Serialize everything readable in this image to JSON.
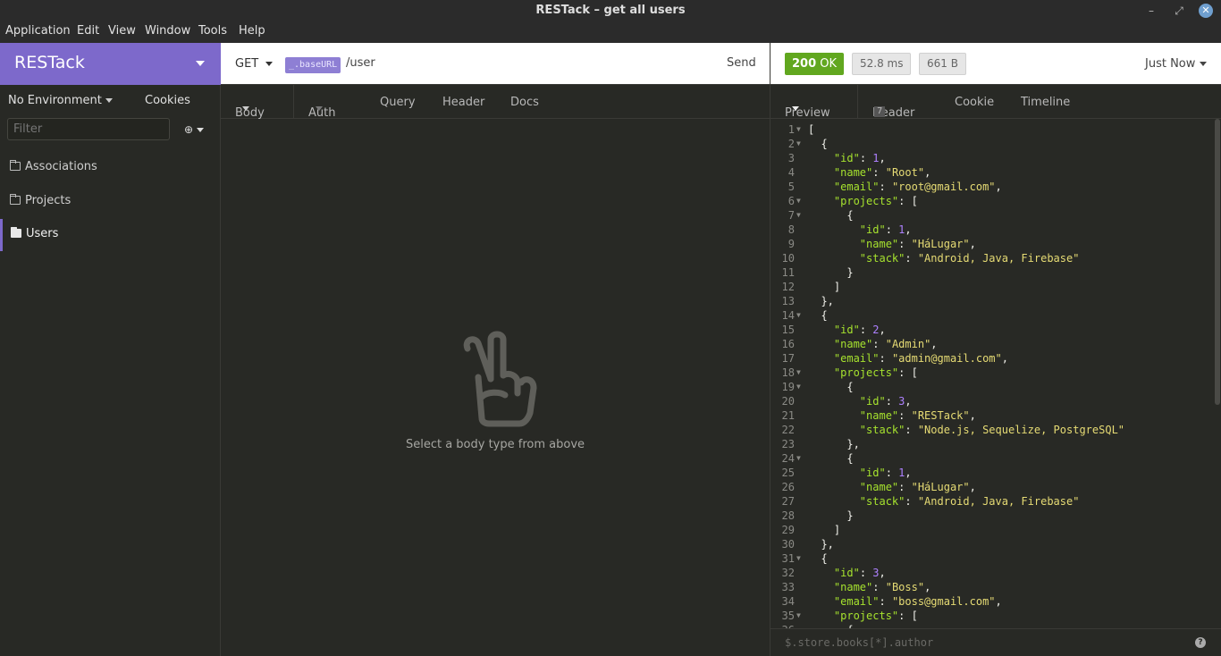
{
  "window": {
    "title": "RESTack – get all users",
    "minimize": "–",
    "maximize": "⤢",
    "close": "✕"
  },
  "menu": [
    "Application",
    "Edit",
    "View",
    "Window",
    "Tools",
    "Help"
  ],
  "sidebar": {
    "workspace": "RESTack",
    "environment": "No Environment",
    "cookies": "Cookies",
    "filter_placeholder": "Filter",
    "add": "⊕",
    "folders": [
      {
        "label": "Associations"
      },
      {
        "label": "Projects"
      },
      {
        "label": "Users"
      }
    ]
  },
  "request": {
    "method": "GET",
    "url_variable": "_.baseURL",
    "url_path": "/user",
    "send": "Send",
    "tabs": [
      "Body",
      "Auth",
      "Query",
      "Header",
      "Docs"
    ],
    "empty_message": "Select a body type from above"
  },
  "response": {
    "status_code": "200",
    "status_text": "OK",
    "time": "52.8 ms",
    "size": "661 B",
    "when": "Just Now",
    "tabs": [
      "Preview",
      "Header",
      "Cookie",
      "Timeline"
    ],
    "header_count": "7",
    "filter_placeholder": "$.store.books[*].author",
    "help": "?"
  },
  "lines": [
    "[",
    "  {",
    "    \"id\": 1,",
    "    \"name\": \"Root\",",
    "    \"email\": \"root@gmail.com\",",
    "    \"projects\": [",
    "      {",
    "        \"id\": 1,",
    "        \"name\": \"HáLugar\",",
    "        \"stack\": \"Android, Java, Firebase\"",
    "      }",
    "    ]",
    "  },",
    "  {",
    "    \"id\": 2,",
    "    \"name\": \"Admin\",",
    "    \"email\": \"admin@gmail.com\",",
    "    \"projects\": [",
    "      {",
    "        \"id\": 3,",
    "        \"name\": \"RESTack\",",
    "        \"stack\": \"Node.js, Sequelize, PostgreSQL\"",
    "      },",
    "      {",
    "        \"id\": 1,",
    "        \"name\": \"HáLugar\",",
    "        \"stack\": \"Android, Java, Firebase\"",
    "      }",
    "    ]",
    "  },",
    "  {",
    "    \"id\": 3,",
    "    \"name\": \"Boss\",",
    "    \"email\": \"boss@gmail.com\",",
    "    \"projects\": [",
    "      {"
  ],
  "fold_lines": [
    1,
    2,
    6,
    7,
    14,
    18,
    19,
    24,
    31,
    35
  ]
}
